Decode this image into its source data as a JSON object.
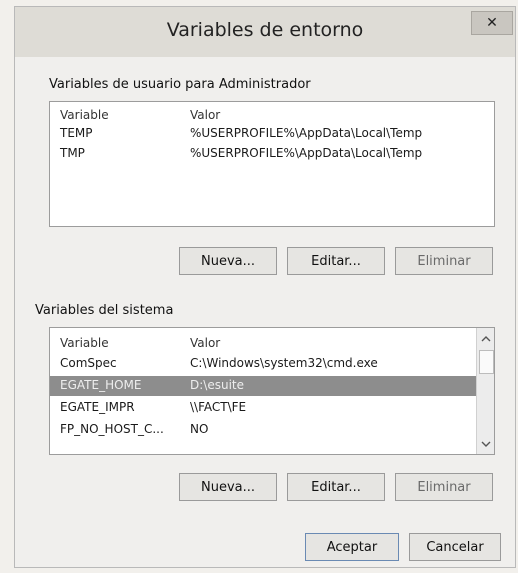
{
  "window": {
    "title": "Variables de entorno",
    "close_glyph": "✕"
  },
  "user_vars": {
    "label": "Variables de usuario para Administrador",
    "columns": [
      "Variable",
      "Valor"
    ],
    "rows": [
      {
        "name": "TEMP",
        "value": "%USERPROFILE%\\AppData\\Local\\Temp"
      },
      {
        "name": "TMP",
        "value": "%USERPROFILE%\\AppData\\Local\\Temp"
      }
    ],
    "new_label": "Nueva...",
    "edit_label": "Editar...",
    "delete_label": "Eliminar"
  },
  "system_vars": {
    "label": "Variables del sistema",
    "columns": [
      "Variable",
      "Valor"
    ],
    "rows": [
      {
        "name": "ComSpec",
        "value": "C:\\Windows\\system32\\cmd.exe"
      },
      {
        "name": "EGATE_HOME",
        "value": "D:\\esuite"
      },
      {
        "name": "EGATE_IMPR",
        "value": "\\\\FACT\\FE"
      },
      {
        "name": "FP_NO_HOST_C...",
        "value": "NO"
      }
    ],
    "selected_index": 1,
    "new_label": "Nueva...",
    "edit_label": "Editar...",
    "delete_label": "Eliminar"
  },
  "footer": {
    "ok_label": "Aceptar",
    "cancel_label": "Cancelar"
  },
  "icons": {
    "scroll_up": "chevron-up-icon",
    "scroll_down": "chevron-down-icon",
    "close": "close-icon"
  }
}
